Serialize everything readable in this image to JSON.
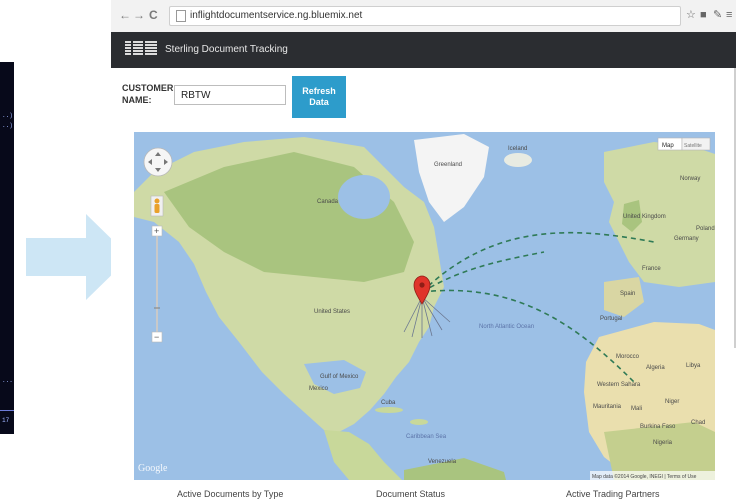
{
  "terminal": {
    "lines": [
      "..)",
      "..)",
      "..."
    ],
    "bottom_number": "17"
  },
  "browser": {
    "back_glyph": "←",
    "forward_glyph": "→",
    "reload_glyph": "C",
    "url": "inflightdocumentservice.ng.bluemix.net",
    "star_icon": "star-icon",
    "extension_icon": "extension-icon",
    "wrench_icon": "wrench-icon",
    "menu_icon": "menu-icon"
  },
  "app": {
    "logo": "IBM",
    "title": "Sterling Document Tracking",
    "customer_label": "CUSTOMER NAME:",
    "customer_value": "RBTW",
    "refresh_label": "Refresh Data"
  },
  "map": {
    "type_buttons": [
      "Map",
      "Satellite"
    ],
    "zoom_in": "+",
    "zoom_out": "−",
    "provider": "Google",
    "attribution": "Map data ©2014 Google, INEGI | Terms of Use",
    "labels": [
      "Canada",
      "United States",
      "Mexico",
      "Gulf of Mexico",
      "Cuba",
      "North Atlantic Ocean",
      "Greenland",
      "Iceland",
      "Norway",
      "United Kingdom",
      "Germany",
      "Poland",
      "France",
      "Spain",
      "Portugal",
      "Morocco",
      "Algeria",
      "Libya",
      "Western Sahara",
      "Mauritania",
      "Mali",
      "Niger",
      "Chad",
      "Burkina Faso",
      "Nigeria",
      "Venezuela",
      "Caribbean Sea"
    ],
    "pin_color": "#e0342a",
    "route_color": "#2f7a56"
  },
  "footer": {
    "labels": [
      "Active Documents by Type",
      "Document Status",
      "Active Trading Partners"
    ]
  }
}
